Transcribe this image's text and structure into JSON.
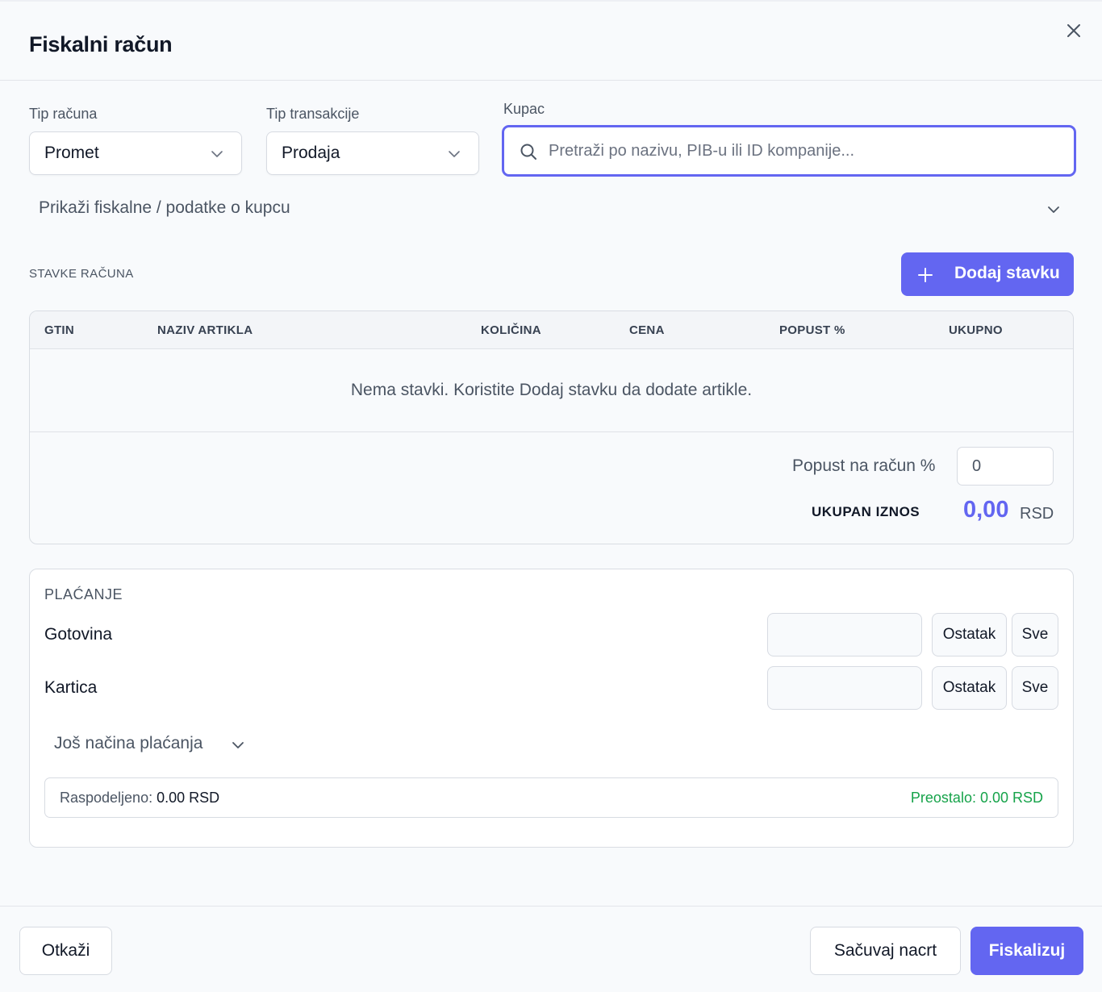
{
  "dialog": {
    "title": "Fiskalni račun",
    "close_icon": "close-icon"
  },
  "form": {
    "receipt_type": {
      "label": "Tip računa",
      "value": "Promet"
    },
    "transaction_type": {
      "label": "Tip transakcije",
      "value": "Prodaja"
    },
    "customer": {
      "label": "Kupac",
      "placeholder": "Pretraži po nazivu, PIB-u ili ID kompanije..."
    },
    "fiscal_toggle_label": "Prikaži fiskalne / podatke o kupcu"
  },
  "items": {
    "section_title": "STAVKE RAČUNA",
    "add_button_label": "Dodaj stavku",
    "columns": [
      "GTIN",
      "NAZIV ARTIKLA",
      "KOLIČINA",
      "CENA",
      "POPUST %",
      "UKUPNO"
    ],
    "empty_message": "Nema stavki. Koristite Dodaj stavku da dodate artikle.",
    "discount_label": "Popust na račun %",
    "discount_value": "0",
    "total_label": "UKUPAN IZNOS",
    "total_value": "0,00",
    "total_currency": "RSD"
  },
  "payment": {
    "title": "PLAĆANJE",
    "methods": [
      {
        "label": "Gotovina",
        "remainder_label": "Ostatak",
        "all_label": "Sve"
      },
      {
        "label": "Kartica",
        "remainder_label": "Ostatak",
        "all_label": "Sve"
      }
    ],
    "more_label": "Još načina plaćanja",
    "allocated_label": "Raspodeljeno:",
    "allocated_value": "0.00 RSD",
    "remaining_text": "Preostalo: 0.00 RSD"
  },
  "footer": {
    "cancel_label": "Otkaži",
    "save_draft_label": "Sačuvaj nacrt",
    "fiscalize_label": "Fiskalizuj"
  },
  "colors": {
    "accent": "#6366f1",
    "success": "#16a34a"
  }
}
